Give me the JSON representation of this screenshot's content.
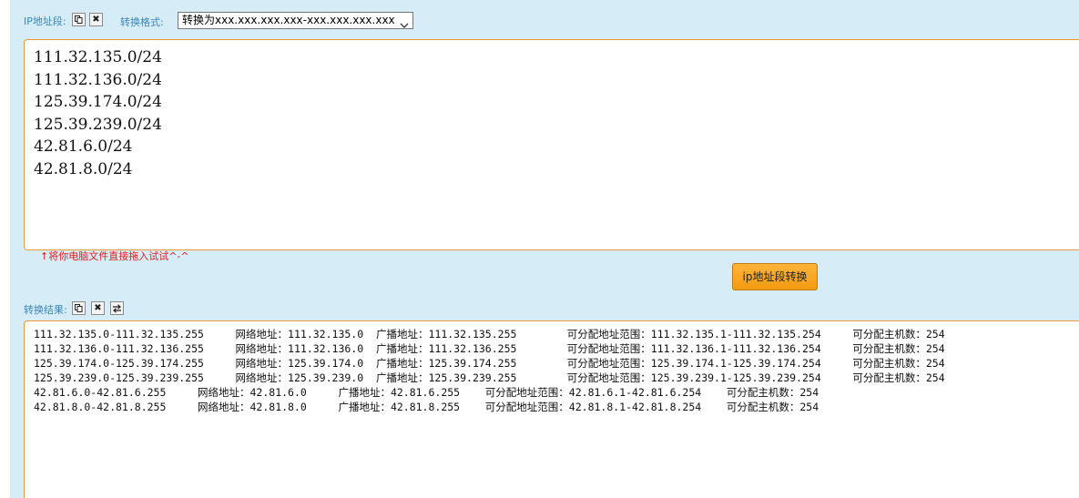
{
  "input_section": {
    "label": "IP地址段:",
    "copy_icon": "copy-icon",
    "clear_icon": "close-icon",
    "format_label": "转换格式:",
    "format_selected": "转换为xxx.xxx.xxx.xxx-xxx.xxx.xxx.xxx",
    "value": "111.32.135.0/24\n111.32.136.0/24\n125.39.174.0/24\n125.39.239.0/24\n42.81.6.0/24\n42.81.8.0/24",
    "hint": "↑将你电脑文件直接拖入试试^-^"
  },
  "actions": {
    "convert_label": "ip地址段转换"
  },
  "output_section": {
    "label": "转换结果:",
    "copy_icon": "copy-icon",
    "clear_icon": "close-icon",
    "swap_icon": "swap-icon",
    "value": "111.32.135.0-111.32.135.255     网络地址：111.32.135.0  广播地址：111.32.135.255        可分配地址范围：111.32.135.1-111.32.135.254     可分配主机数：254\n111.32.136.0-111.32.136.255     网络地址：111.32.136.0  广播地址：111.32.136.255        可分配地址范围：111.32.136.1-111.32.136.254     可分配主机数：254\n125.39.174.0-125.39.174.255     网络地址：125.39.174.0  广播地址：125.39.174.255        可分配地址范围：125.39.174.1-125.39.174.254     可分配主机数：254\n125.39.239.0-125.39.239.255     网络地址：125.39.239.0  广播地址：125.39.239.255        可分配地址范围：125.39.239.1-125.39.239.254     可分配主机数：254\n42.81.6.0-42.81.6.255     网络地址：42.81.6.0     广播地址：42.81.6.255    可分配地址范围：42.81.6.1-42.81.6.254    可分配主机数：254\n42.81.8.0-42.81.8.255     网络地址：42.81.8.0     广播地址：42.81.8.255    可分配地址范围：42.81.8.1-42.81.8.254    可分配主机数：254"
  }
}
